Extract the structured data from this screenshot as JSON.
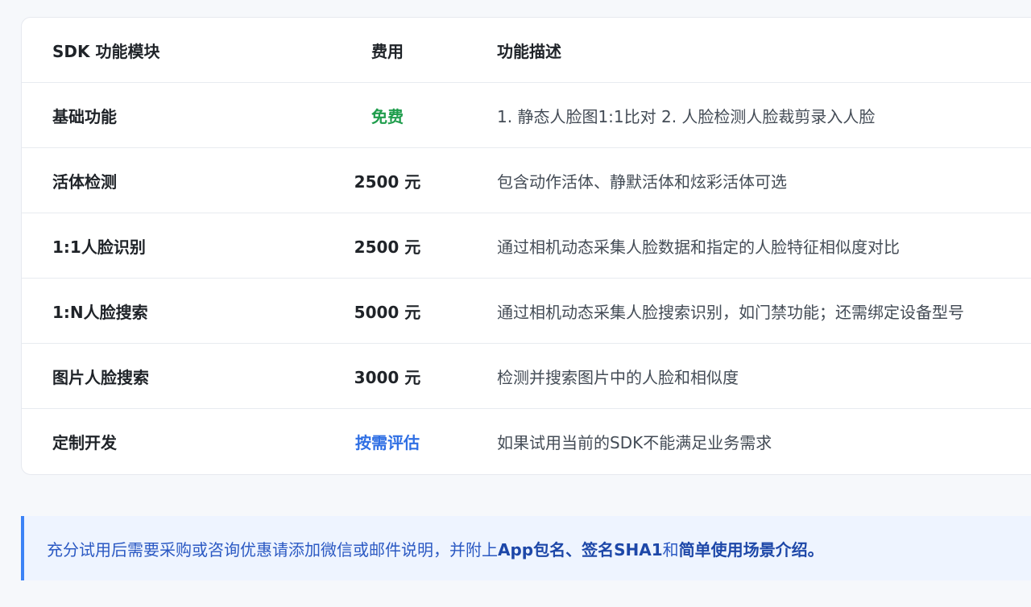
{
  "table": {
    "headers": [
      "SDK 功能模块",
      "费用",
      "功能描述"
    ],
    "rows": [
      {
        "module": "基础功能",
        "price": "免费",
        "desc": "1. 静态人脸图1:1比对  2. 人脸检测人脸裁剪录入人脸"
      },
      {
        "module": "活体检测",
        "price": "2500 元",
        "desc": "包含动作活体、静默活体和炫彩活体可选"
      },
      {
        "module": "1:1人脸识别",
        "price": "2500 元",
        "desc": "通过相机动态采集人脸数据和指定的人脸特征相似度对比"
      },
      {
        "module": "1:N人脸搜索",
        "price": "5000 元",
        "desc": "通过相机动态采集人脸搜索识别，如门禁功能；还需绑定设备型号"
      },
      {
        "module": "图片人脸搜索",
        "price": "3000 元",
        "desc": "检测并搜索图片中的人脸和相似度"
      },
      {
        "module": "定制开发",
        "price": "按需评估",
        "desc": "如果试用当前的SDK不能满足业务需求"
      }
    ]
  },
  "notice": {
    "prefix": "充分试用后需要采购或咨询优惠请添加微信或邮件说明，并附上 ",
    "bold1": "App包名、签名SHA1",
    "mid": " 和 ",
    "bold2": "简单使用场景介绍。"
  },
  "colors": {
    "free": "#1f9d4c",
    "evaluate": "#2f6fe4",
    "notice_accent": "#3b82f6"
  }
}
